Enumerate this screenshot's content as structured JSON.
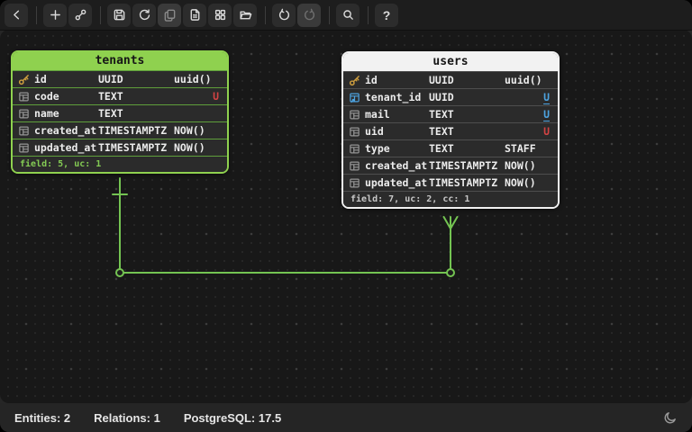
{
  "toolbar": {
    "help_label": "?",
    "icons": [
      "chevron-left-icon",
      "add-table-icon",
      "add-relation-icon",
      "save-icon",
      "reload-icon",
      "copy-icon",
      "export-file-icon",
      "templates-grid-icon",
      "open-folder-icon",
      "undo-icon",
      "redo-icon",
      "search-icon",
      "help-icon"
    ],
    "disabled_buttons": [
      "copy",
      "redo"
    ]
  },
  "colors": {
    "green_accent": "#8fd14f",
    "users_accent": "#f2f2f2",
    "relation_line": "#74c452",
    "blue_unique": "#4da3e0",
    "red_unique": "#d24343",
    "key_gold": "#cf9f3f"
  },
  "entities": [
    {
      "name": "tenants",
      "footer": "field: 5, uc: 1",
      "colors": {
        "accent": "#8fd14f",
        "header_text": "#161616",
        "separator": "#5f9f3b",
        "footer_text": "#84cb54"
      },
      "fields": [
        {
          "name": "id",
          "type": "UUID",
          "default": "uuid()",
          "icon": "key"
        },
        {
          "name": "code",
          "type": "TEXT",
          "default": "",
          "icon": "field",
          "badge": "U",
          "badge_style": "red"
        },
        {
          "name": "name",
          "type": "TEXT",
          "default": "",
          "icon": "field"
        },
        {
          "name": "created_at",
          "type": "TIMESTAMPTZ",
          "default": "NOW()",
          "icon": "field"
        },
        {
          "name": "updated_at",
          "type": "TIMESTAMPTZ",
          "default": "NOW()",
          "icon": "field"
        }
      ]
    },
    {
      "name": "users",
      "footer": "field: 7, uc: 2, cc: 1",
      "colors": {
        "accent": "#f2f2f2",
        "header_text": "#161616",
        "separator": "#4e4e4e",
        "footer_text": "#c9c9c9"
      },
      "fields": [
        {
          "name": "id",
          "type": "UUID",
          "default": "uuid()",
          "icon": "key"
        },
        {
          "name": "tenant_id",
          "type": "UUID",
          "default": "",
          "icon": "fk",
          "badge": "U",
          "badge_style": "blue"
        },
        {
          "name": "mail",
          "type": "TEXT",
          "default": "",
          "icon": "field",
          "badge": "U",
          "badge_style": "blue"
        },
        {
          "name": "uid",
          "type": "TEXT",
          "default": "",
          "icon": "field",
          "badge": "U",
          "badge_style": "red"
        },
        {
          "name": "type",
          "type": "TEXT",
          "default": "STAFF",
          "icon": "field",
          "default_underline": true
        },
        {
          "name": "created_at",
          "type": "TIMESTAMPTZ",
          "default": "NOW()",
          "icon": "field"
        },
        {
          "name": "updated_at",
          "type": "TIMESTAMPTZ",
          "default": "NOW()",
          "icon": "field"
        }
      ]
    }
  ],
  "relation": {
    "from": "tenants",
    "to": "users",
    "cardinality": "one-to-many"
  },
  "statusbar": {
    "entities_label": "Entities: 2",
    "relations_label": "Relations: 1",
    "database_label": "PostgreSQL: 17.5"
  }
}
